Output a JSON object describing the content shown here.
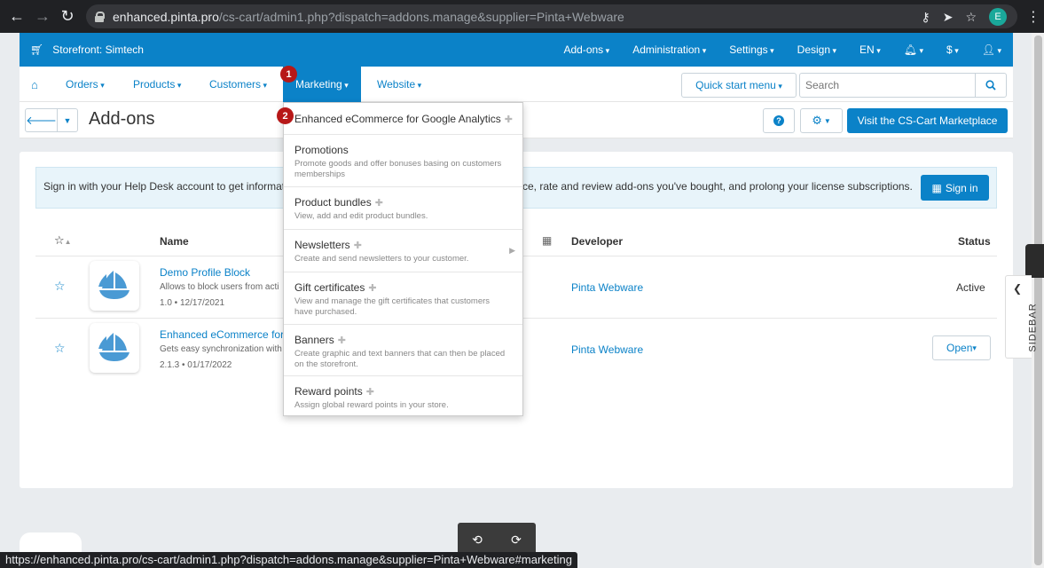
{
  "browser": {
    "url_host": "enhanced.pinta.pro",
    "url_path": "/cs-cart/admin1.php?dispatch=addons.manage&supplier=Pinta+Webware",
    "profile_initial": "E"
  },
  "topbar": {
    "storefront": "Storefront: Simtech",
    "menu": [
      "Add-ons",
      "Administration",
      "Settings",
      "Design",
      "EN",
      "",
      "$",
      ""
    ]
  },
  "subnav": {
    "items": [
      "Orders",
      "Products",
      "Customers",
      "Marketing",
      "Website"
    ],
    "quick_start": "Quick start menu",
    "search_placeholder": "Search"
  },
  "titlebar": {
    "title": "Add-ons",
    "marketplace": "Visit the CS-Cart Marketplace"
  },
  "info": {
    "text_left": "Sign in with your Help Desk account to get informat",
    "text_right": "ce, rate and review add-ons you've bought, and prolong your license subscriptions.",
    "signin": "Sign in"
  },
  "table": {
    "headers": {
      "name": "Name",
      "developer": "Developer",
      "status": "Status"
    },
    "rows": [
      {
        "name": "Demo Profile Block",
        "desc": "Allows to block users from acti",
        "version": "1.0 • 12/17/2021",
        "developer": "Pinta Webware",
        "status": "Active"
      },
      {
        "name": "Enhanced eCommerce for",
        "desc": "Gets easy synchronization with",
        "version": "2.1.3 • 01/17/2022",
        "developer": "Pinta Webware",
        "status": "Open"
      }
    ]
  },
  "dropdown": {
    "items": [
      {
        "title": "Enhanced eCommerce for Google Analytics",
        "desc": ""
      },
      {
        "title": "Promotions",
        "desc": "Promote goods and offer bonuses basing on customers memberships"
      },
      {
        "title": "Product bundles",
        "desc": "View, add and edit product bundles."
      },
      {
        "title": "Newsletters",
        "desc": "Create and send newsletters to your customer."
      },
      {
        "title": "Gift certificates",
        "desc": "View and manage the gift certificates that customers have purchased."
      },
      {
        "title": "Banners",
        "desc": "Create graphic and text banners that can then be placed on the storefront."
      },
      {
        "title": "Reward points",
        "desc": "Assign global reward points in your store."
      }
    ]
  },
  "badges": [
    "1",
    "2"
  ],
  "sidebar": {
    "label": "SIDEBAR"
  },
  "status_bar": "https://enhanced.pinta.pro/cs-cart/admin1.php?dispatch=addons.manage&supplier=Pinta+Webware#marketing"
}
